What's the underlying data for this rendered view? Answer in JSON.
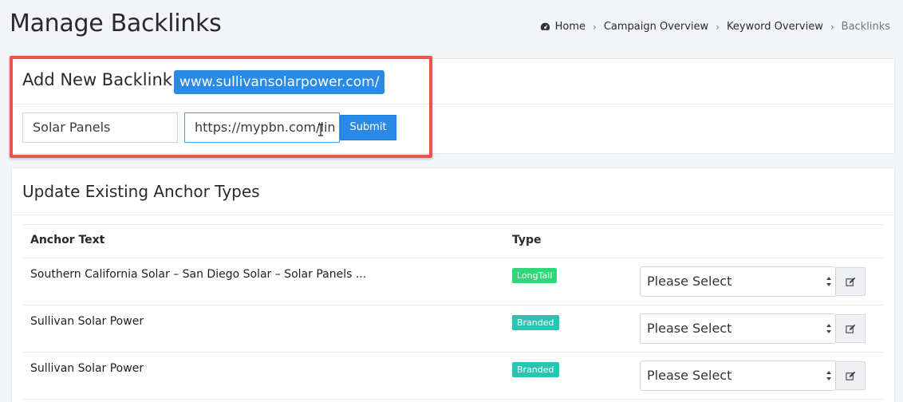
{
  "page": {
    "title": "Manage Backlinks"
  },
  "breadcrumb": {
    "icon": "dashboard-icon",
    "items": [
      "Home",
      "Campaign Overview",
      "Keyword Overview",
      "Backlinks"
    ]
  },
  "add_backlink": {
    "title": "Add New Backlink",
    "domain": "www.sullivansolarpower.com/",
    "keyword_value": "Solar Panels",
    "url_value": "https://mypbn.com/lin",
    "submit_label": "Submit"
  },
  "update_anchors": {
    "title": "Update Existing Anchor Types",
    "columns": [
      "Anchor Text",
      "Type"
    ],
    "rows": [
      {
        "anchor": "Southern California Solar – San Diego Solar – Solar Panels ...",
        "type": "LongTail",
        "type_color": "#2fd67a",
        "select": "Please Select"
      },
      {
        "anchor": "Sullivan Solar Power",
        "type": "Branded",
        "type_color": "#2bc4b3",
        "select": "Please Select"
      },
      {
        "anchor": "Sullivan Solar Power",
        "type": "Branded",
        "type_color": "#2bc4b3",
        "select": "Please Select"
      }
    ]
  },
  "colors": {
    "accent": "#2a8be6",
    "highlight": "#e9564b"
  }
}
